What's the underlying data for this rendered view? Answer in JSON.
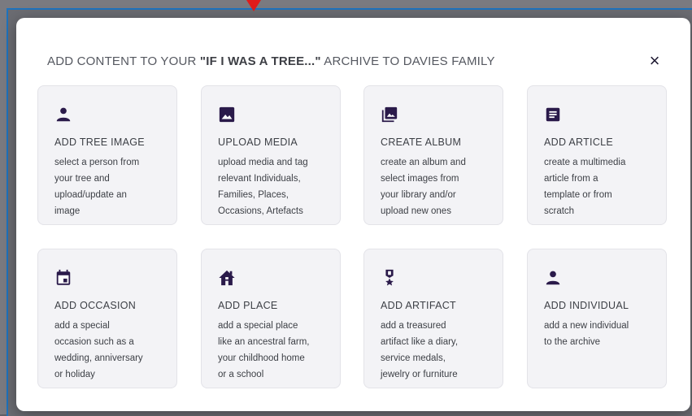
{
  "colors": {
    "accent": "#2a1a4a",
    "card_bg": "#f3f3f6",
    "text": "#3c3f45",
    "marker": "#e01b1b"
  },
  "modal": {
    "title_prefix": "ADD CONTENT TO YOUR ",
    "archive_name": "\"IF I WAS A TREE...\"",
    "title_suffix": " ARCHIVE TO DAVIES FAMILY",
    "close_label": "×"
  },
  "cards": [
    {
      "title": "ADD TREE IMAGE",
      "desc": [
        "select a person from",
        "your tree and",
        "upload/update an",
        "image"
      ],
      "icon": "person-icon"
    },
    {
      "title": "UPLOAD MEDIA",
      "desc": [
        "upload media and tag",
        "relevant Individuals,",
        "Families, Places,",
        "Occasions, Artefacts"
      ],
      "icon": "image-icon"
    },
    {
      "title": "CREATE ALBUM",
      "desc": [
        "create an album and",
        "select images from",
        "your library and/or",
        "upload new ones"
      ],
      "icon": "album-icon"
    },
    {
      "title": "ADD ARTICLE",
      "desc": [
        "create a multimedia",
        "article from a",
        "template or from",
        "scratch"
      ],
      "icon": "article-icon"
    },
    {
      "title": "ADD OCCASION",
      "desc": [
        "add a special",
        "occasion such as a",
        "wedding, anniversary",
        "or holiday"
      ],
      "icon": "calendar-icon"
    },
    {
      "title": "ADD PLACE",
      "desc": [
        "add a special place",
        "like an ancestral farm,",
        "your childhood home",
        "or a school"
      ],
      "icon": "home-icon"
    },
    {
      "title": "ADD ARTIFACT",
      "desc": [
        "add a treasured",
        "artifact like a diary,",
        "service medals,",
        "jewelry or furniture"
      ],
      "icon": "medal-icon"
    },
    {
      "title": "ADD INDIVIDUAL",
      "desc": [
        "add a new individual",
        "to the archive"
      ],
      "icon": "person-icon"
    }
  ]
}
